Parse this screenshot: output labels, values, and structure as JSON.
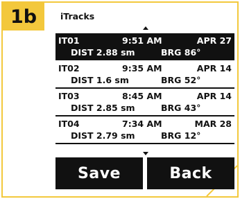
{
  "step": {
    "label": "1b"
  },
  "screen": {
    "title": "iTracks",
    "tracks": [
      {
        "id": "IT01",
        "time": "9:51 AM",
        "date": "APR 27",
        "dist": "DIST 2.88 sm",
        "brg": "BRG 86°",
        "selected": true
      },
      {
        "id": "IT02",
        "time": "9:35 AM",
        "date": "APR 14",
        "dist": "DIST 1.6 sm",
        "brg": "BRG 52°",
        "selected": false
      },
      {
        "id": "IT03",
        "time": "8:45 AM",
        "date": "APR 14",
        "dist": "DIST 2.85 sm",
        "brg": "BRG 43°",
        "selected": false
      },
      {
        "id": "IT04",
        "time": "7:34 AM",
        "date": "MAR 28",
        "dist": "DIST 2.79 sm",
        "brg": "BRG 12°",
        "selected": false
      }
    ],
    "buttons": {
      "save_label": "Save",
      "back_label": "Back"
    }
  },
  "colors": {
    "accent": "#f3c83c",
    "screen_fg": "#111111",
    "screen_bg": "#ffffff"
  },
  "icons": {
    "scroll_up": "triangle-up-icon",
    "scroll_down": "triangle-down-icon"
  }
}
